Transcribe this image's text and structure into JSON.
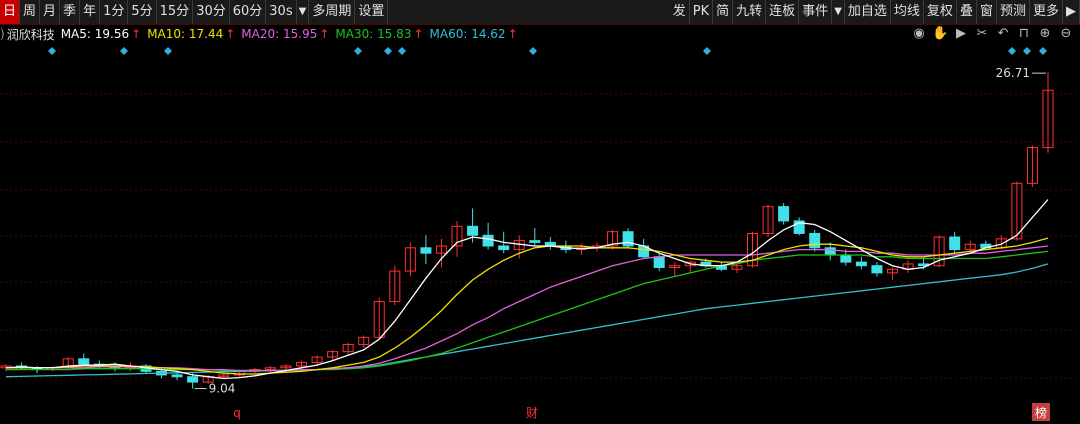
{
  "toolbar": {
    "left": [
      "日",
      "周",
      "月",
      "季",
      "年",
      "1分",
      "5分",
      "15分",
      "30分",
      "60分",
      "30s",
      "多周期",
      "设置"
    ],
    "right": [
      "发",
      "PK",
      "简",
      "九转",
      "连板",
      "事件",
      "加自选",
      "均线",
      "复权",
      "叠",
      "窗",
      "预测",
      "更多"
    ],
    "active_index": 0,
    "dropdown_glyph": "▼",
    "right_arrow_glyph": "▶"
  },
  "stock": {
    "prefix": ")",
    "name": "润欣科技",
    "ma5_label": "MA5: 19.56",
    "ma10_label": "MA10: 17.44",
    "ma20_label": "MA20: 15.95",
    "ma30_label": "MA30: 15.83",
    "ma60_label": "MA60: 14.62",
    "arrow": "↑"
  },
  "icons": [
    "eye-icon",
    "hand-icon",
    "play-icon",
    "scissors-icon",
    "undo-icon",
    "lock-icon",
    "plus-icon",
    "zoom-icon"
  ],
  "colors": {
    "ma5": "#ffffff",
    "ma10": "#f0e000",
    "ma20": "#e060e0",
    "ma30": "#20c020",
    "ma60": "#30c0d0",
    "up": "#ff3030",
    "down": "#40e0e8",
    "grid": "#5a0000",
    "marker": "#30b0e0"
  },
  "chart_data": {
    "type": "candlestick",
    "high_label": "26.71",
    "low_label": "9.04",
    "markers_bottom": [
      "q",
      "财",
      "榜"
    ],
    "ylim": [
      8.4,
      27.5
    ],
    "candles": [
      [
        10.2,
        10.4,
        10.0,
        10.3
      ],
      [
        10.3,
        10.5,
        10.1,
        10.2
      ],
      [
        10.2,
        10.3,
        9.9,
        10.1
      ],
      [
        10.1,
        10.3,
        10.0,
        10.2
      ],
      [
        10.2,
        10.8,
        10.1,
        10.7
      ],
      [
        10.7,
        11.0,
        10.3,
        10.4
      ],
      [
        10.4,
        10.6,
        10.1,
        10.3
      ],
      [
        10.3,
        10.5,
        10.0,
        10.2
      ],
      [
        10.2,
        10.5,
        10.0,
        10.3
      ],
      [
        10.3,
        10.4,
        9.9,
        10.0
      ],
      [
        10.0,
        10.2,
        9.6,
        9.8
      ],
      [
        9.8,
        10.0,
        9.5,
        9.7
      ],
      [
        9.7,
        9.9,
        9.04,
        9.4
      ],
      [
        9.4,
        9.8,
        9.3,
        9.7
      ],
      [
        9.7,
        9.9,
        9.6,
        9.8
      ],
      [
        9.8,
        10.1,
        9.7,
        10.0
      ],
      [
        10.0,
        10.2,
        9.9,
        10.1
      ],
      [
        10.1,
        10.3,
        9.9,
        10.2
      ],
      [
        10.2,
        10.4,
        10.0,
        10.3
      ],
      [
        10.3,
        10.6,
        10.1,
        10.5
      ],
      [
        10.5,
        10.9,
        10.3,
        10.8
      ],
      [
        10.8,
        11.2,
        10.6,
        11.1
      ],
      [
        11.1,
        11.6,
        10.9,
        11.5
      ],
      [
        11.5,
        12.0,
        11.3,
        11.9
      ],
      [
        11.9,
        14.1,
        11.8,
        13.9
      ],
      [
        13.9,
        15.9,
        13.7,
        15.6
      ],
      [
        15.6,
        17.2,
        15.3,
        16.9
      ],
      [
        16.9,
        17.6,
        16.0,
        16.6
      ],
      [
        16.6,
        17.4,
        15.8,
        17.0
      ],
      [
        17.0,
        18.4,
        16.4,
        18.1
      ],
      [
        18.1,
        19.1,
        17.2,
        17.6
      ],
      [
        17.6,
        18.3,
        16.8,
        17.0
      ],
      [
        17.0,
        17.8,
        16.6,
        16.8
      ],
      [
        16.8,
        17.6,
        16.3,
        17.3
      ],
      [
        17.3,
        18.0,
        17.0,
        17.2
      ],
      [
        17.2,
        17.5,
        16.8,
        17.0
      ],
      [
        17.0,
        17.3,
        16.6,
        16.8
      ],
      [
        16.8,
        17.1,
        16.5,
        16.9
      ],
      [
        16.9,
        17.2,
        16.7,
        17.0
      ],
      [
        17.0,
        17.9,
        16.8,
        17.8
      ],
      [
        17.8,
        18.0,
        16.9,
        17.0
      ],
      [
        17.0,
        17.4,
        16.3,
        16.4
      ],
      [
        16.4,
        16.6,
        15.6,
        15.8
      ],
      [
        15.8,
        16.1,
        15.3,
        15.9
      ],
      [
        15.9,
        16.2,
        15.5,
        16.1
      ],
      [
        16.1,
        16.3,
        15.8,
        15.9
      ],
      [
        15.9,
        16.1,
        15.6,
        15.7
      ],
      [
        15.7,
        16.0,
        15.5,
        15.9
      ],
      [
        15.9,
        17.8,
        15.8,
        17.7
      ],
      [
        17.7,
        19.3,
        17.5,
        19.2
      ],
      [
        19.2,
        19.4,
        18.2,
        18.4
      ],
      [
        18.4,
        18.6,
        17.6,
        17.7
      ],
      [
        17.7,
        17.9,
        16.7,
        16.9
      ],
      [
        16.9,
        17.2,
        16.2,
        16.5
      ],
      [
        16.5,
        16.8,
        15.9,
        16.1
      ],
      [
        16.1,
        16.4,
        15.7,
        15.9
      ],
      [
        15.9,
        16.1,
        15.3,
        15.5
      ],
      [
        15.5,
        15.8,
        15.1,
        15.7
      ],
      [
        15.7,
        16.2,
        15.5,
        16.0
      ],
      [
        16.0,
        16.4,
        15.7,
        15.9
      ],
      [
        15.9,
        17.6,
        15.8,
        17.5
      ],
      [
        17.5,
        17.8,
        16.6,
        16.8
      ],
      [
        16.8,
        17.3,
        16.6,
        17.1
      ],
      [
        17.1,
        17.3,
        16.8,
        16.9
      ],
      [
        16.9,
        17.6,
        16.8,
        17.4
      ],
      [
        17.4,
        20.6,
        17.3,
        20.5
      ],
      [
        20.5,
        22.6,
        20.3,
        22.5
      ],
      [
        22.5,
        26.71,
        22.2,
        25.7
      ]
    ],
    "ma": {
      "ma5": [
        10.2,
        10.25,
        10.2,
        10.2,
        10.3,
        10.35,
        10.35,
        10.4,
        10.3,
        10.2,
        10.1,
        10.0,
        9.8,
        9.7,
        9.6,
        9.65,
        9.75,
        9.9,
        10.05,
        10.2,
        10.35,
        10.6,
        10.9,
        11.2,
        11.8,
        12.8,
        14.0,
        15.2,
        16.3,
        17.2,
        17.5,
        17.4,
        17.2,
        17.1,
        17.0,
        17.0,
        16.9,
        16.85,
        16.9,
        17.1,
        17.2,
        17.0,
        16.6,
        16.3,
        16.0,
        15.9,
        15.9,
        16.1,
        16.6,
        17.3,
        17.9,
        18.3,
        18.2,
        17.8,
        17.3,
        16.8,
        16.3,
        15.9,
        15.7,
        15.8,
        16.2,
        16.4,
        16.6,
        16.9,
        17.1,
        17.6,
        18.6,
        19.6
      ],
      "ma10": [
        10.2,
        10.2,
        10.2,
        10.2,
        10.25,
        10.3,
        10.3,
        10.3,
        10.3,
        10.25,
        10.2,
        10.15,
        10.1,
        10.0,
        9.9,
        9.85,
        9.85,
        9.9,
        9.95,
        10.0,
        10.1,
        10.2,
        10.35,
        10.5,
        10.8,
        11.3,
        11.9,
        12.6,
        13.4,
        14.3,
        15.1,
        15.7,
        16.2,
        16.6,
        16.9,
        17.0,
        17.0,
        17.0,
        16.9,
        16.9,
        16.9,
        16.8,
        16.7,
        16.5,
        16.3,
        16.2,
        16.1,
        16.1,
        16.2,
        16.5,
        16.8,
        17.0,
        17.1,
        17.1,
        17.0,
        16.9,
        16.7,
        16.5,
        16.4,
        16.4,
        16.5,
        16.6,
        16.7,
        16.8,
        16.9,
        17.0,
        17.2,
        17.44
      ],
      "ma20": [
        10.2,
        10.2,
        10.2,
        10.2,
        10.2,
        10.2,
        10.25,
        10.25,
        10.25,
        10.25,
        10.2,
        10.2,
        10.15,
        10.1,
        10.1,
        10.05,
        10.05,
        10.05,
        10.05,
        10.1,
        10.1,
        10.15,
        10.2,
        10.3,
        10.45,
        10.7,
        11.0,
        11.3,
        11.7,
        12.1,
        12.6,
        13.0,
        13.5,
        13.9,
        14.3,
        14.7,
        15.0,
        15.3,
        15.6,
        15.9,
        16.1,
        16.3,
        16.4,
        16.5,
        16.5,
        16.5,
        16.5,
        16.5,
        16.5,
        16.6,
        16.7,
        16.8,
        16.8,
        16.8,
        16.7,
        16.7,
        16.6,
        16.6,
        16.5,
        16.5,
        16.5,
        16.5,
        16.6,
        16.6,
        16.7,
        16.8,
        16.9,
        17.0
      ],
      "ma30": [
        10.1,
        10.1,
        10.1,
        10.1,
        10.1,
        10.15,
        10.15,
        10.15,
        10.15,
        10.15,
        10.1,
        10.1,
        10.1,
        10.1,
        10.05,
        10.05,
        10.05,
        10.05,
        10.05,
        10.05,
        10.1,
        10.1,
        10.15,
        10.2,
        10.3,
        10.45,
        10.6,
        10.8,
        11.0,
        11.3,
        11.6,
        11.9,
        12.2,
        12.5,
        12.8,
        13.1,
        13.4,
        13.7,
        14.0,
        14.3,
        14.6,
        14.9,
        15.1,
        15.3,
        15.5,
        15.7,
        15.9,
        16.0,
        16.2,
        16.3,
        16.4,
        16.5,
        16.5,
        16.5,
        16.5,
        16.5,
        16.4,
        16.4,
        16.3,
        16.3,
        16.3,
        16.3,
        16.3,
        16.3,
        16.4,
        16.5,
        16.6,
        16.7
      ],
      "ma60": [
        9.7,
        9.72,
        9.74,
        9.76,
        9.78,
        9.8,
        9.82,
        9.84,
        9.86,
        9.88,
        9.9,
        9.92,
        9.94,
        9.96,
        9.98,
        10.0,
        10.02,
        10.04,
        10.06,
        10.08,
        10.1,
        10.15,
        10.2,
        10.25,
        10.35,
        10.5,
        10.65,
        10.8,
        10.95,
        11.1,
        11.25,
        11.4,
        11.55,
        11.7,
        11.85,
        12.0,
        12.15,
        12.3,
        12.45,
        12.6,
        12.75,
        12.9,
        13.05,
        13.2,
        13.35,
        13.5,
        13.6,
        13.7,
        13.8,
        13.9,
        14.0,
        14.1,
        14.2,
        14.3,
        14.4,
        14.5,
        14.6,
        14.7,
        14.8,
        14.9,
        15.0,
        15.1,
        15.2,
        15.3,
        15.4,
        15.55,
        15.75,
        16.0
      ]
    }
  }
}
